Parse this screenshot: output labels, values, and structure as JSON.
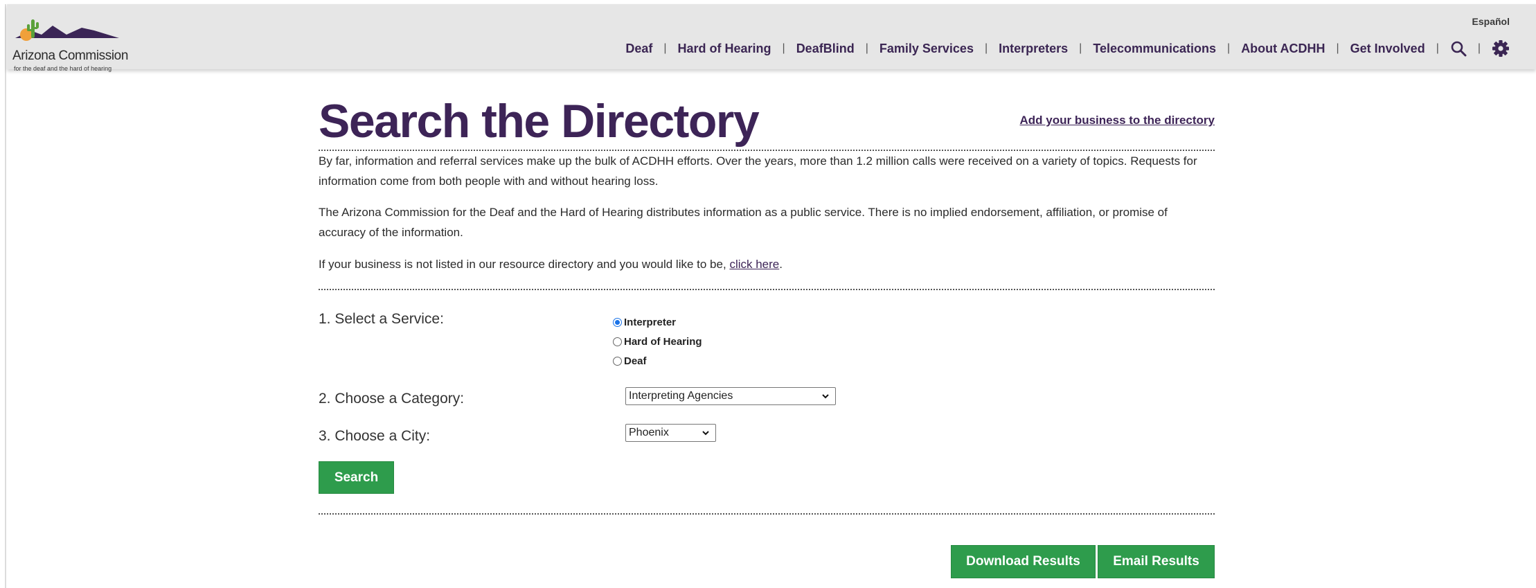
{
  "header": {
    "logo": {
      "title": "Arizona Commission",
      "subtitle": "for the deaf and the hard of hearing"
    },
    "language_link": "Español",
    "nav": [
      {
        "label": "Deaf"
      },
      {
        "label": "Hard of Hearing"
      },
      {
        "label": "DeafBlind"
      },
      {
        "label": "Family Services"
      },
      {
        "label": "Interpreters"
      },
      {
        "label": "Telecommunications"
      },
      {
        "label": "About ACDHH"
      },
      {
        "label": "Get Involved"
      }
    ],
    "icons": [
      "search-icon",
      "gear-icon"
    ]
  },
  "main": {
    "title": "Search the Directory",
    "add_business_link": "Add your business to the directory",
    "paragraphs": [
      "By far, information and referral services make up the bulk of ACDHH efforts. Over the years, more than 1.2 million calls were received on a variety of topics. Requests for information come from both people with and without hearing loss.",
      "The Arizona Commission for the Deaf and the Hard of Hearing distributes information as a public service. There is no implied endorsement, affiliation, or promise of accuracy of the information."
    ],
    "listing_text": "If your business is not listed in our resource directory and you would like to be,",
    "listing_link": "click here",
    "listing_end": "."
  },
  "form": {
    "service_label": "1. Select a Service:",
    "services": [
      {
        "label": "Interpreter",
        "selected": true
      },
      {
        "label": "Hard of Hearing",
        "selected": false
      },
      {
        "label": "Deaf",
        "selected": false
      }
    ],
    "category_label": "2. Choose a Category:",
    "category_value": "Interpreting Agencies",
    "city_label": "3. Choose a City:",
    "city_value": "Phoenix",
    "search_button": "Search"
  },
  "results": {
    "download_button": "Download Results",
    "email_button": "Email Results"
  },
  "colors": {
    "brand_purple": "#3d2457",
    "button_green": "#2e9c4c",
    "header_bg": "#e6e6e6"
  }
}
